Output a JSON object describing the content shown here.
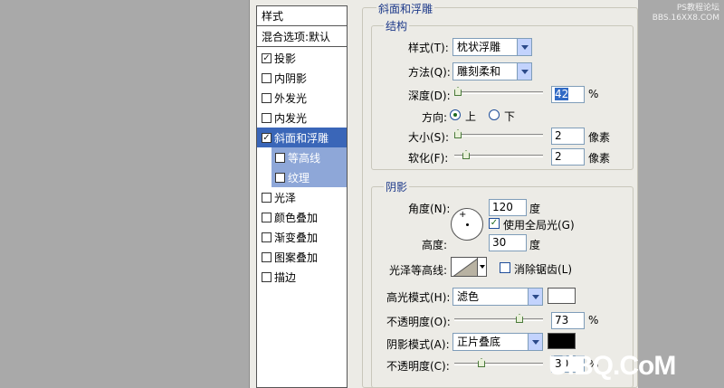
{
  "styles_list": {
    "header": "样式",
    "blend_options": "混合选项:默认",
    "items": [
      {
        "label": "投影",
        "checked": true
      },
      {
        "label": "内阴影",
        "checked": false
      },
      {
        "label": "外发光",
        "checked": false
      },
      {
        "label": "内发光",
        "checked": false
      },
      {
        "label": "斜面和浮雕",
        "checked": true,
        "selected": true
      },
      {
        "label": "等高线",
        "checked": false,
        "sub": true
      },
      {
        "label": "纹理",
        "checked": false,
        "sub": true
      },
      {
        "label": "光泽",
        "checked": false
      },
      {
        "label": "颜色叠加",
        "checked": false
      },
      {
        "label": "渐变叠加",
        "checked": false
      },
      {
        "label": "图案叠加",
        "checked": false
      },
      {
        "label": "描边",
        "checked": false
      }
    ]
  },
  "bevel": {
    "section_title": "斜面和浮雕",
    "structure": {
      "title": "结构",
      "style_label": "样式(T):",
      "style_value": "枕状浮雕",
      "technique_label": "方法(Q):",
      "technique_value": "雕刻柔和",
      "depth_label": "深度(D):",
      "depth_value": "42",
      "depth_unit": "%",
      "depth_level": 0.042,
      "direction_label": "方向:",
      "direction_up": "上",
      "direction_down": "下",
      "direction_selected": "上",
      "size_label": "大小(S):",
      "size_value": "2",
      "size_unit": "像素",
      "soften_label": "软化(F):",
      "soften_value": "2",
      "soften_unit": "像素"
    },
    "shading": {
      "title": "阴影",
      "angle_label": "角度(N):",
      "angle_value": "120",
      "angle_unit": "度",
      "global_light_label": "使用全局光(G)",
      "global_light_checked": true,
      "altitude_label": "高度:",
      "altitude_value": "30",
      "altitude_unit": "度",
      "gloss_contour_label": "光泽等高线:",
      "anti_aliased_label": "消除锯齿(L)",
      "anti_aliased_checked": false,
      "highlight_mode_label": "高光模式(H):",
      "highlight_mode_value": "滤色",
      "highlight_color": "#ffffff",
      "highlight_opacity_label": "不透明度(O):",
      "highlight_opacity_value": "73",
      "highlight_opacity_unit": "%",
      "shadow_mode_label": "阴影模式(A):",
      "shadow_mode_value": "正片叠底",
      "shadow_color": "#000000",
      "shadow_opacity_label": "不透明度(C):",
      "shadow_opacity_value": "30",
      "shadow_opacity_unit": "%"
    }
  },
  "watermark": {
    "top_line1": "PS教程论坛",
    "top_line2": "BBS.16XX8.COM",
    "bottom": "UiBQ.CoM"
  }
}
